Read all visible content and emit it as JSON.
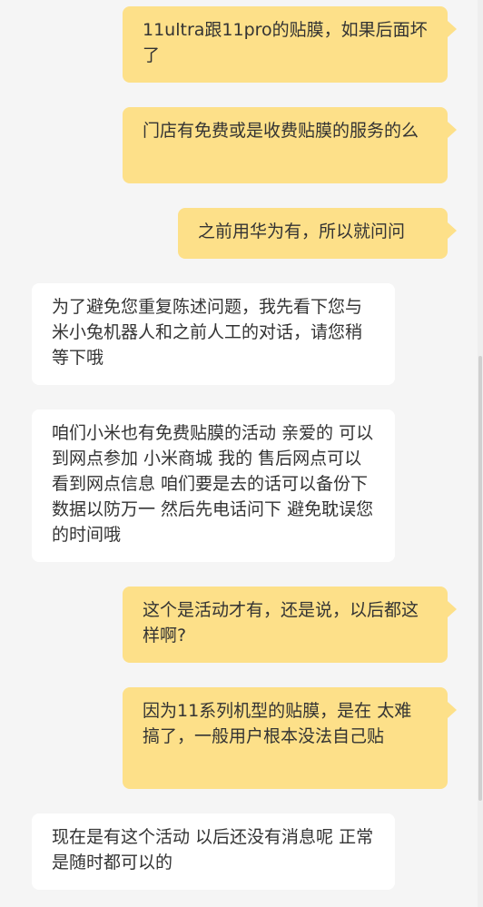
{
  "messages": [
    {
      "role": "user",
      "text": "11ultra跟11pro的贴膜，如果后面坏了"
    },
    {
      "role": "user",
      "text": "门店有免费或是收费贴膜的服务的么"
    },
    {
      "role": "user",
      "text": "之前用华为有，所以就问问"
    },
    {
      "role": "agent",
      "text": "为了避免您重复陈述问题，我先看下您与米小兔机器人和之前人工的对话，请您稍等下哦"
    },
    {
      "role": "agent",
      "text": "咱们小米也有免费贴膜的活动 亲爱的 可以到网点参加 小米商城 我的 售后网点可以看到网点信息 咱们要是去的话可以备份下数据以防万一 然后先电话问下 避免耽误您的时间哦"
    },
    {
      "role": "user",
      "text": "这个是活动才有，还是说，以后都这样啊?"
    },
    {
      "role": "user",
      "text": "因为11系列机型的贴膜，是在 太难搞了，一般用户根本没法自己贴"
    },
    {
      "role": "agent",
      "text": "现在是有这个活动 以后还没有消息呢 正常是随时都可以的"
    }
  ],
  "colors": {
    "background": "#f5f5f5",
    "user_bubble": "#fde089",
    "agent_bubble": "#ffffff",
    "text": "#333333"
  }
}
